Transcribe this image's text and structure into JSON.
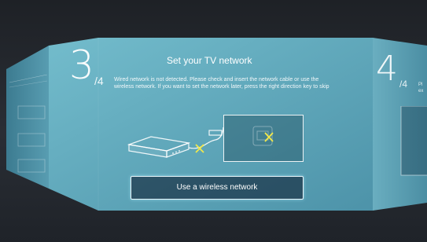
{
  "wizard": {
    "current_step": "3",
    "total_label": "/4",
    "title": "Set your TV network",
    "description": "Wired network is not detected. Please check and insert the network cable or use the wireless network. If you want to set the network later, press the right direction key to skip",
    "primary_button": "Use a wireless network"
  },
  "next_panel": {
    "step": "4",
    "total_label": "/4",
    "desc_line1": "Pl",
    "desc_line2": "ex"
  },
  "colors": {
    "panel_gradient_start": "#6fb6c7",
    "panel_gradient_end": "#4e93a8",
    "error_mark": "#f2e84a"
  }
}
